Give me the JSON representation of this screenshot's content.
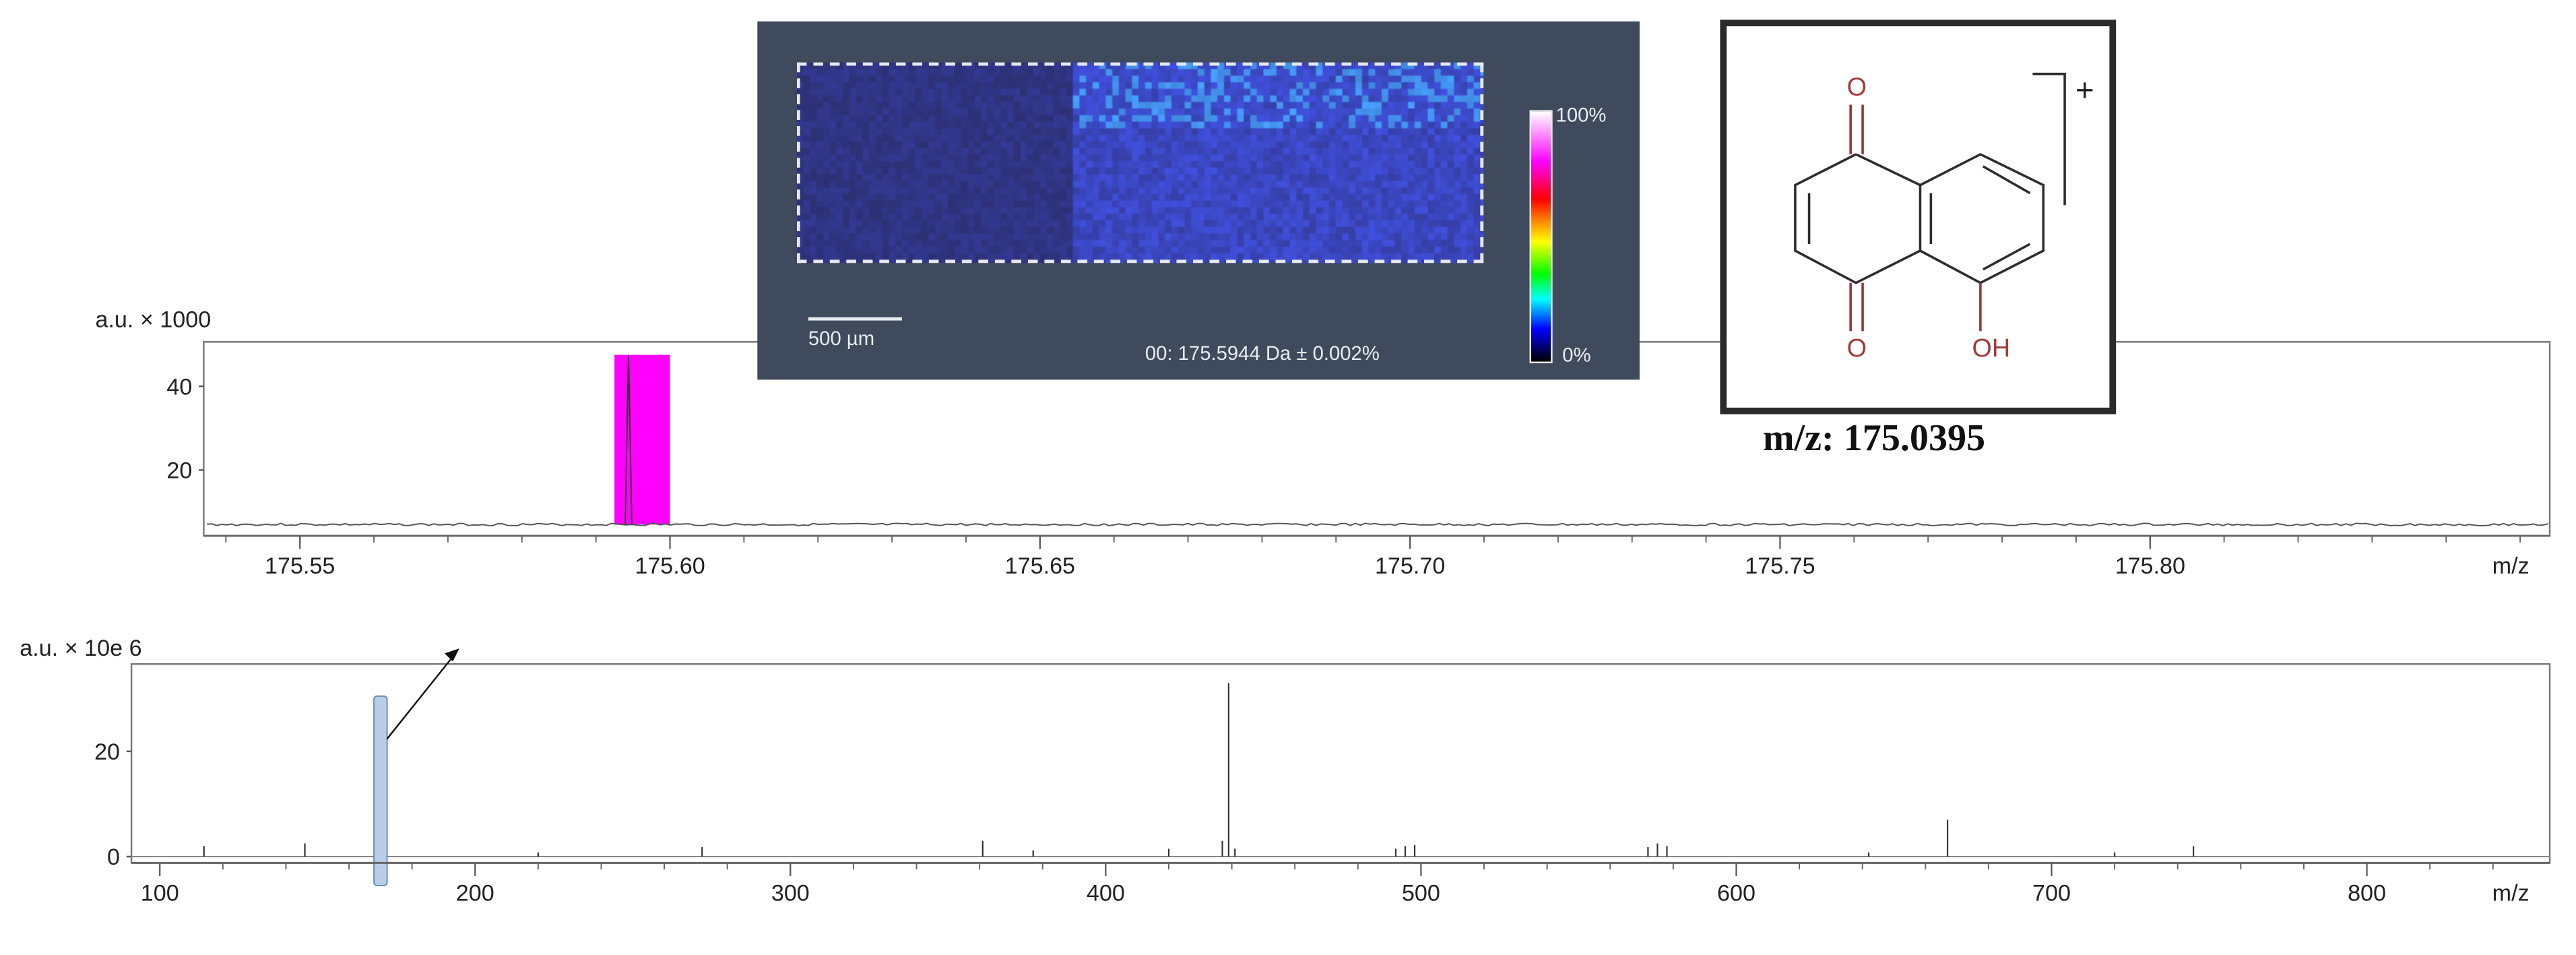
{
  "image_panel": {
    "caption": "00: 175.5944 Da ± 0.002%",
    "scale_bar": "500 µm",
    "colorbar_max": "100%",
    "colorbar_min": "0%"
  },
  "structure": {
    "atoms": {
      "o_top": "O",
      "o_bottom": "O",
      "oh": "OH"
    },
    "charge": "+",
    "mz_label": "m/z: 175.0395"
  },
  "chart_data": [
    {
      "type": "line",
      "title": "",
      "ylabel": "a.u. × 1000",
      "xlabel": "m/z",
      "xlim": [
        175.537,
        175.854
      ],
      "ylim": [
        4.3,
        50.6
      ],
      "xticks": [
        175.55,
        175.6,
        175.65,
        175.7,
        175.75,
        175.8
      ],
      "xtick_labels": [
        "175.55",
        "175.60",
        "175.65",
        "175.70",
        "175.75",
        "175.80"
      ],
      "yticks": [
        20,
        40
      ],
      "ytick_labels": [
        "20",
        "40"
      ],
      "baseline": 7,
      "peak": {
        "x": 175.5944,
        "y": 47.5
      },
      "highlight": {
        "x_range": [
          175.5925,
          175.6
        ],
        "height": 47.5,
        "color": "#ff00ff"
      },
      "grid": false
    },
    {
      "type": "bar",
      "title": "",
      "ylabel": "a.u. × 10e 6",
      "xlabel": "m/z",
      "xlim": [
        91,
        858
      ],
      "ylim": [
        -1.2,
        36.6
      ],
      "xticks": [
        100,
        200,
        300,
        400,
        500,
        600,
        700,
        800
      ],
      "xtick_labels": [
        "100",
        "200",
        "300",
        "400",
        "500",
        "600",
        "700",
        "800"
      ],
      "yticks": [
        0,
        20
      ],
      "ytick_labels": [
        "0",
        "20"
      ],
      "peaks": [
        {
          "x": 114,
          "y": 2
        },
        {
          "x": 146,
          "y": 2.5
        },
        {
          "x": 220,
          "y": 0.8
        },
        {
          "x": 272,
          "y": 1.8
        },
        {
          "x": 361,
          "y": 3
        },
        {
          "x": 377,
          "y": 1.2
        },
        {
          "x": 420,
          "y": 1.5
        },
        {
          "x": 437,
          "y": 3
        },
        {
          "x": 439,
          "y": 33
        },
        {
          "x": 441,
          "y": 1.5
        },
        {
          "x": 492,
          "y": 1.5
        },
        {
          "x": 495,
          "y": 2
        },
        {
          "x": 498,
          "y": 2.2
        },
        {
          "x": 572,
          "y": 1.8
        },
        {
          "x": 575,
          "y": 2.5
        },
        {
          "x": 578,
          "y": 2
        },
        {
          "x": 642,
          "y": 0.8
        },
        {
          "x": 667,
          "y": 7
        },
        {
          "x": 720,
          "y": 0.8
        },
        {
          "x": 745,
          "y": 2
        }
      ],
      "highlight": {
        "x": 170,
        "y_range": [
          -5.5,
          30.5
        ],
        "color": "#b8cde8"
      },
      "grid": false
    }
  ]
}
